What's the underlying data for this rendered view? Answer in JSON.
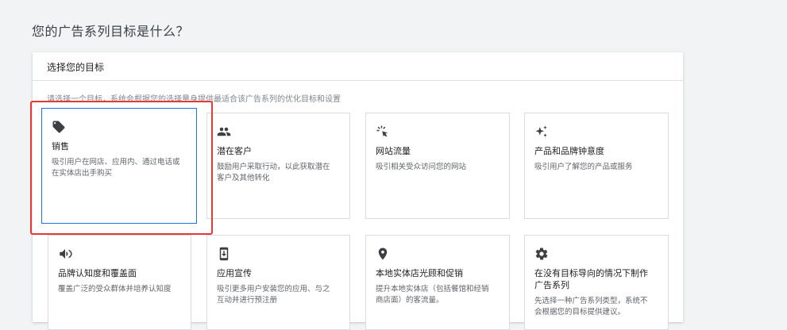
{
  "page": {
    "title": "您的广告系列目标是什么？"
  },
  "panel": {
    "header": "选择您的目标",
    "description": "请选择一个目标，系统会根据您的选择量身提供最适合该广告系列的优化目标和设置"
  },
  "goals": [
    {
      "title": "销售",
      "desc": "吸引用户在网店、应用内、通过电话或在实体店出手购买",
      "icon": "tag-icon",
      "selected": true
    },
    {
      "title": "潜在客户",
      "desc": "鼓励用户采取行动，以此获取潜在客户及其他转化",
      "icon": "people-icon"
    },
    {
      "title": "网站流量",
      "desc": "吸引相关受众访问您的网站",
      "icon": "cursor-click-icon"
    },
    {
      "title": "产品和品牌钟意度",
      "desc": "吸引用户了解您的产品或服务",
      "icon": "sparkle-icon"
    },
    {
      "title": "品牌认知度和覆盖面",
      "desc": "覆盖广泛的受众群体并培养认知度",
      "icon": "megaphone-icon"
    },
    {
      "title": "应用宣传",
      "desc": "吸引更多用户安装您的应用、与之互动并进行预注册",
      "icon": "phone-app-icon"
    },
    {
      "title": "本地实体店光顾和促销",
      "desc": "提升本地实体店（包括餐馆和经销商店面）的客流量。",
      "icon": "location-pin-icon"
    },
    {
      "title": "在没有目标导向的情况下制作广告系列",
      "desc": "先选择一种广告系列类型，系统不会根据您的目标提供建议。",
      "icon": "gear-icon"
    }
  ],
  "colors": {
    "selected_border": "#1a73e8",
    "highlight": "#e53935"
  }
}
